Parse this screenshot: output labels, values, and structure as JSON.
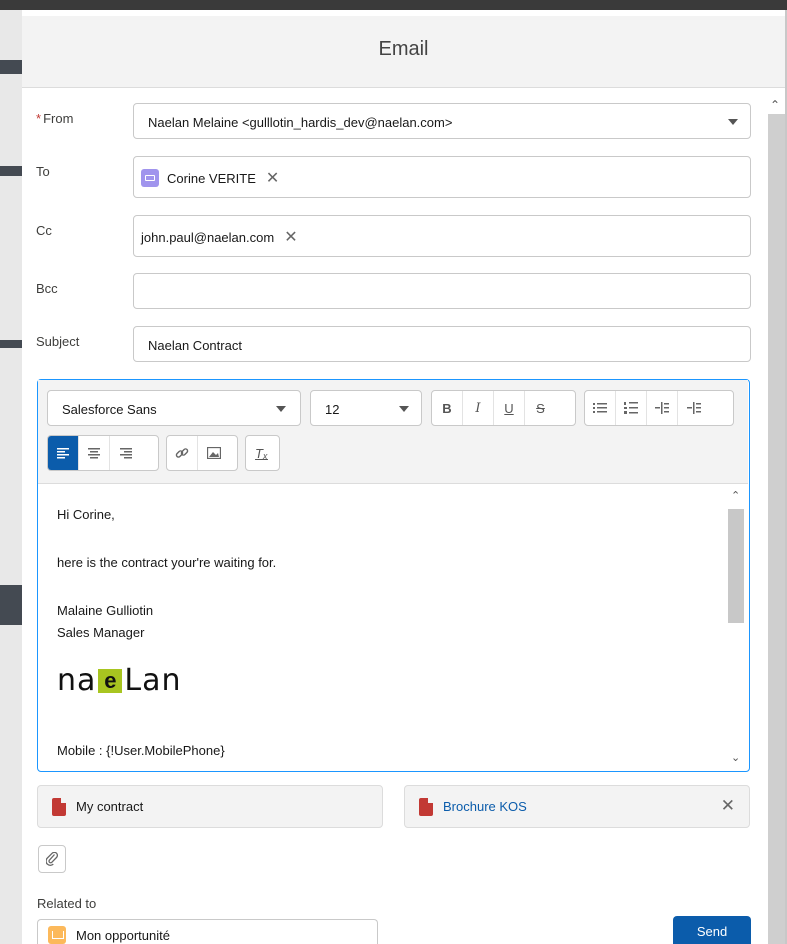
{
  "modal": {
    "title": "Email"
  },
  "form": {
    "from": {
      "label": "From",
      "value": "Naelan Melaine <gulllotin_hardis_dev@naelan.com>"
    },
    "to": {
      "label": "To",
      "recipients": [
        "Corine VERITE"
      ]
    },
    "cc": {
      "label": "Cc",
      "recipients": [
        "john.paul@naelan.com"
      ]
    },
    "bcc": {
      "label": "Bcc",
      "value": ""
    },
    "subject": {
      "label": "Subject",
      "value": "Naelan Contract"
    }
  },
  "toolbar": {
    "font_family": "Salesforce Sans",
    "font_size": "12",
    "icons": [
      "bold-icon",
      "italic-icon",
      "underline-icon",
      "strikethrough-icon",
      "bulleted-list-icon",
      "numbered-list-icon",
      "indent-icon",
      "outdent-icon",
      "align-left-icon",
      "align-center-icon",
      "align-right-icon",
      "link-icon",
      "image-icon",
      "clear-format-icon"
    ],
    "labels": {
      "bold": "B",
      "italic": "I",
      "underline": "U",
      "strike": "S",
      "clear": "Tₓ"
    }
  },
  "body": {
    "greeting": "Hi Corine,",
    "message": "here is the contract your're waiting for.",
    "signature_name": "Malaine Gulliotin",
    "signature_title": "Sales Manager",
    "logo_text": {
      "a": "na",
      "e": "e",
      "b": "Lan"
    },
    "mobile": "Mobile : {!User.MobilePhone}"
  },
  "attachments": [
    {
      "name": "My contract",
      "color": "#181818"
    },
    {
      "name": "Brochure KOS",
      "color": "#0b5cab"
    }
  ],
  "related": {
    "label": "Related to",
    "value": "Mon opportunité"
  },
  "actions": {
    "send_label": "Send"
  },
  "colors": {
    "accent": "#0b5cab",
    "focus": "#1b96ff",
    "pdf": "#c23934",
    "contact": "#a094ed",
    "opportunity": "#fcb95b"
  }
}
